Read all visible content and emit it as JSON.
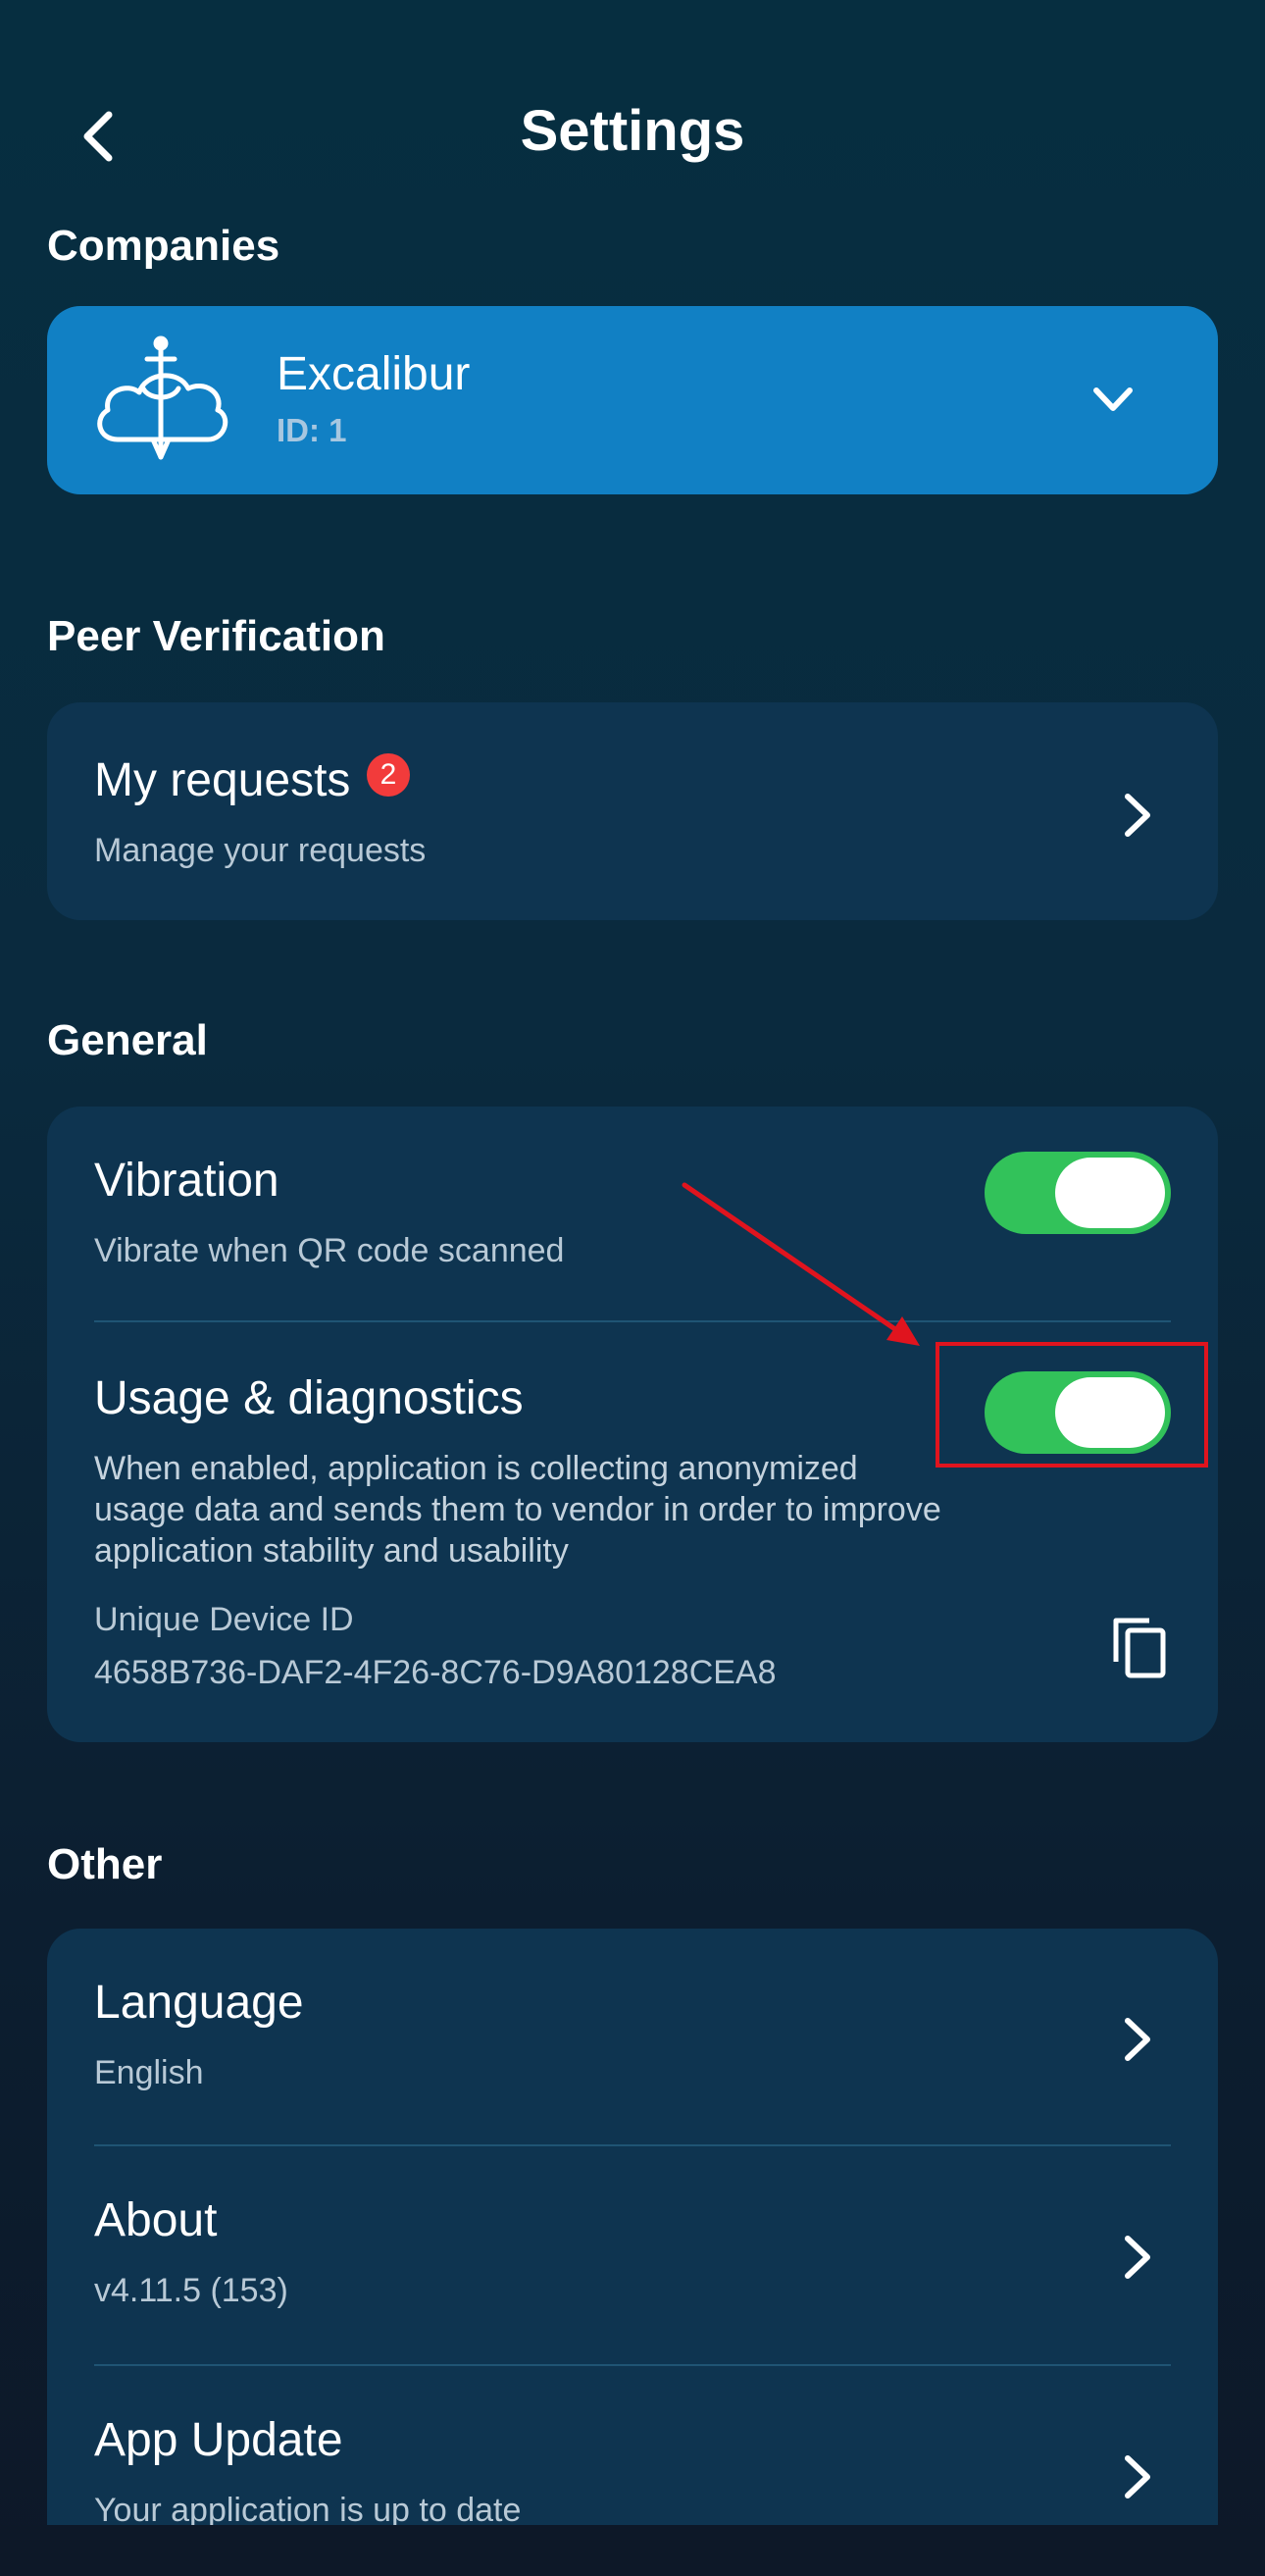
{
  "header": {
    "title": "Settings"
  },
  "companies": {
    "section_title": "Companies",
    "name": "Excalibur",
    "id_label": "ID: 1"
  },
  "peer_verification": {
    "section_title": "Peer Verification",
    "my_requests": {
      "title": "My requests",
      "badge": "2",
      "subtitle": "Manage your requests"
    }
  },
  "general": {
    "section_title": "General",
    "vibration": {
      "title": "Vibration",
      "subtitle": "Vibrate when QR code scanned",
      "enabled": true
    },
    "usage": {
      "title": "Usage & diagnostics",
      "description": "When enabled, application is collecting anonymized usage data and sends them to vendor in order to improve application stability and usability",
      "enabled": true,
      "device_id_label": "Unique Device ID",
      "device_id_value": "4658B736-DAF2-4F26-8C76-D9A80128CEA8"
    }
  },
  "other": {
    "section_title": "Other",
    "language": {
      "title": "Language",
      "value": "English"
    },
    "about": {
      "title": "About",
      "value": "v4.11.5 (153)"
    },
    "app_update": {
      "title": "App Update",
      "value": "Your application is up to date"
    }
  },
  "colors": {
    "accent_blue": "#1180c4",
    "toggle_on": "#32c25a",
    "badge_red": "#f23b3b",
    "annotation_red": "#e0141e"
  },
  "icons": [
    "back-arrow-icon",
    "company-logo-icon",
    "chevron-down-icon",
    "chevron-right-icon",
    "copy-icon"
  ]
}
